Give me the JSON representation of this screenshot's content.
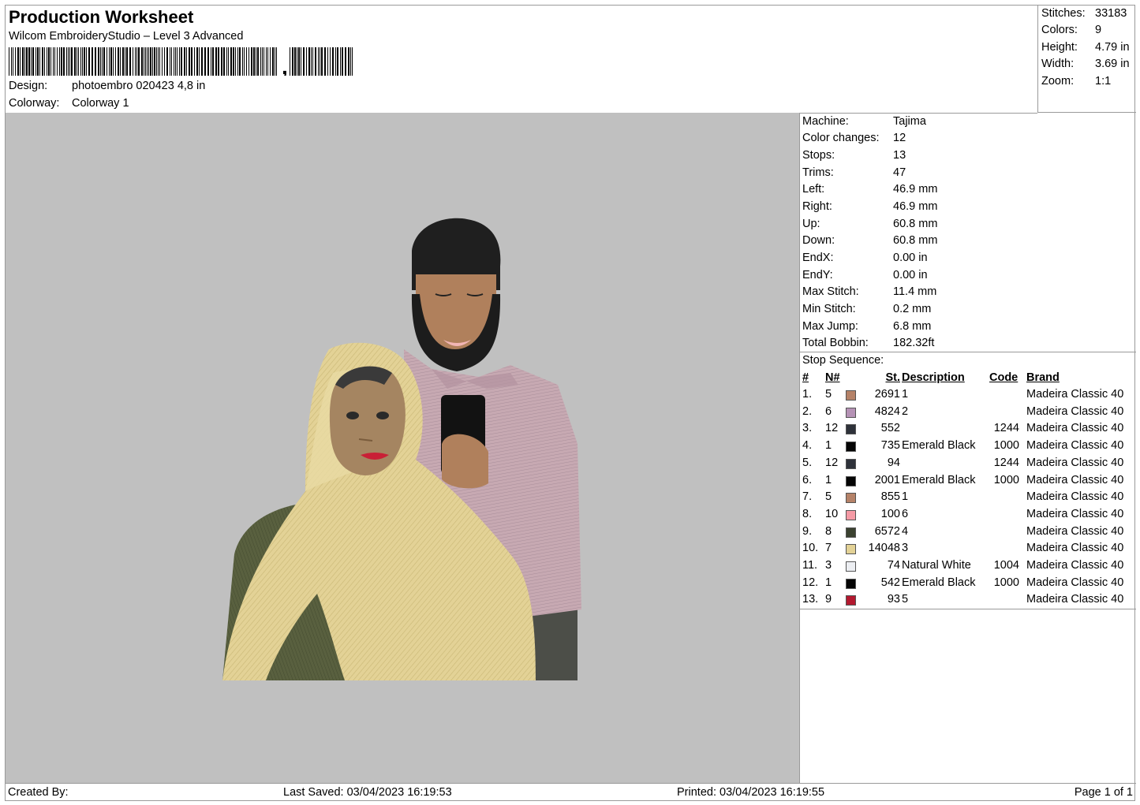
{
  "header": {
    "title": "Production Worksheet",
    "software": "Wilcom EmbroideryStudio – Level 3 Advanced",
    "barcode_suffix": ",",
    "design_label": "Design:",
    "design_value": "photoembro 020423 4,8 in",
    "colorway_label": "Colorway:",
    "colorway_value": "Colorway 1"
  },
  "stats": [
    {
      "label": "Stitches:",
      "value": "33183"
    },
    {
      "label": "Colors:",
      "value": "9"
    },
    {
      "label": "Height:",
      "value": "4.79 in"
    },
    {
      "label": "Width:",
      "value": "3.69 in"
    },
    {
      "label": "Zoom:",
      "value": "1:1"
    }
  ],
  "machine": [
    {
      "label": "Machine:",
      "value": "Tajima"
    },
    {
      "label": "Color changes:",
      "value": "12"
    },
    {
      "label": "Stops:",
      "value": "13"
    },
    {
      "label": "Trims:",
      "value": "47"
    },
    {
      "label": "Left:",
      "value": "46.9 mm"
    },
    {
      "label": "Right:",
      "value": "46.9 mm"
    },
    {
      "label": "Up:",
      "value": "60.8 mm"
    },
    {
      "label": "Down:",
      "value": "60.8 mm"
    },
    {
      "label": "EndX:",
      "value": "0.00 in"
    },
    {
      "label": "EndY:",
      "value": "0.00 in"
    },
    {
      "label": "Max Stitch:",
      "value": "11.4 mm"
    },
    {
      "label": "Min Stitch:",
      "value": "0.2 mm"
    },
    {
      "label": "Max Jump:",
      "value": "6.8 mm"
    },
    {
      "label": "Total Bobbin:",
      "value": "182.32ft"
    }
  ],
  "stop_sequence": {
    "title": "Stop Sequence:",
    "headers": {
      "num": "#",
      "n": "N#",
      "st": "St.",
      "desc": "Description",
      "code": "Code",
      "brand": "Brand"
    },
    "rows": [
      {
        "num": "1.",
        "n": "5",
        "color": "#b58268",
        "st": "2691",
        "desc": "1",
        "code": "",
        "brand": "Madeira Classic 40"
      },
      {
        "num": "2.",
        "n": "6",
        "color": "#b592b5",
        "st": "4824",
        "desc": "2",
        "code": "",
        "brand": "Madeira Classic 40"
      },
      {
        "num": "3.",
        "n": "12",
        "color": "#2e323a",
        "st": "552",
        "desc": "",
        "code": "1244",
        "brand": "Madeira Classic 40"
      },
      {
        "num": "4.",
        "n": "1",
        "color": "#050505",
        "st": "735",
        "desc": "Emerald Black",
        "code": "1000",
        "brand": "Madeira Classic 40"
      },
      {
        "num": "5.",
        "n": "12",
        "color": "#2e323a",
        "st": "94",
        "desc": "",
        "code": "1244",
        "brand": "Madeira Classic 40"
      },
      {
        "num": "6.",
        "n": "1",
        "color": "#050505",
        "st": "2001",
        "desc": "Emerald Black",
        "code": "1000",
        "brand": "Madeira Classic 40"
      },
      {
        "num": "7.",
        "n": "5",
        "color": "#b58268",
        "st": "855",
        "desc": "1",
        "code": "",
        "brand": "Madeira Classic 40"
      },
      {
        "num": "8.",
        "n": "10",
        "color": "#f59aa5",
        "st": "100",
        "desc": "6",
        "code": "",
        "brand": "Madeira Classic 40"
      },
      {
        "num": "9.",
        "n": "8",
        "color": "#3b4230",
        "st": "6572",
        "desc": "4",
        "code": "",
        "brand": "Madeira Classic 40"
      },
      {
        "num": "10.",
        "n": "7",
        "color": "#e3d296",
        "st": "14048",
        "desc": "3",
        "code": "",
        "brand": "Madeira Classic 40"
      },
      {
        "num": "11.",
        "n": "3",
        "color": "#eceef2",
        "st": "74",
        "desc": "Natural White",
        "code": "1004",
        "brand": "Madeira Classic 40"
      },
      {
        "num": "12.",
        "n": "1",
        "color": "#050505",
        "st": "542",
        "desc": "Emerald Black",
        "code": "1000",
        "brand": "Madeira Classic 40"
      },
      {
        "num": "13.",
        "n": "9",
        "color": "#b3192f",
        "st": "93",
        "desc": "5",
        "code": "",
        "brand": "Madeira Classic 40"
      }
    ]
  },
  "footer": {
    "created_by": "Created By:",
    "last_saved": "Last Saved: 03/04/2023 16:19:53",
    "printed": "Printed: 03/04/2023 16:19:55",
    "page": "Page 1 of 1"
  }
}
